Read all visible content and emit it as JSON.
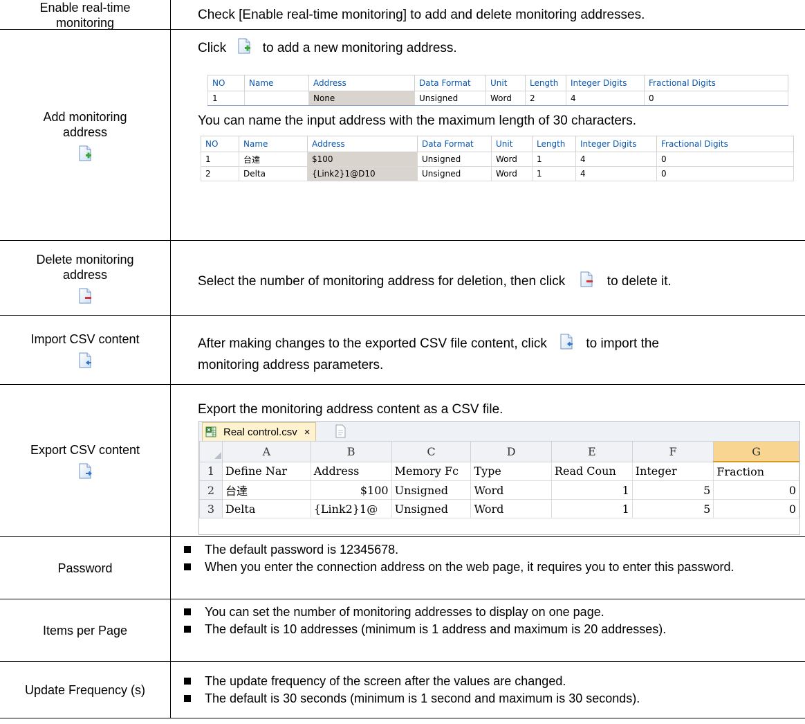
{
  "rows": {
    "enable": {
      "label": "Enable real-time monitoring",
      "text": "Check [Enable real-time monitoring] to add and delete monitoring addresses."
    },
    "add": {
      "label": "Add monitoring address",
      "text_click": "Click",
      "text_after": "to add a new monitoring address.",
      "text2": "You can name the input address with the maximum length of 30 characters."
    },
    "delete": {
      "label": "Delete monitoring address",
      "text_before": "Select the number of monitoring address for deletion, then click",
      "text_after": "to delete it."
    },
    "import": {
      "label": "Import CSV content",
      "text_before": "After making changes to the exported CSV file content, click",
      "text_after": "to import the",
      "text_line2": "monitoring address parameters."
    },
    "export": {
      "label": "Export CSV content",
      "text": "Export the monitoring address content as a CSV file."
    },
    "password": {
      "label": "Password",
      "bullets": [
        "The default password is 12345678.",
        "When you enter the connection address on the web page, it requires you to enter this password."
      ]
    },
    "items": {
      "label": "Items per Page",
      "bullets": [
        "You can set the number of monitoring addresses to display on one page.",
        "The default is 10 addresses (minimum is 1 address and maximum is 20 addresses)."
      ]
    },
    "update": {
      "label": "Update Frequency (s)",
      "bullets": [
        "The update frequency of the screen after the values are changed.",
        "The default is 30 seconds (minimum is 1 second and maximum is 30 seconds)."
      ]
    }
  },
  "grid1": {
    "headers": [
      "NO",
      "Name",
      "Address",
      "Data Format",
      "Unit",
      "Length",
      "Integer Digits",
      "Fractional Digits"
    ],
    "rows": [
      [
        "1",
        "",
        "None",
        "Unsigned",
        "Word",
        "2",
        "4",
        "0"
      ]
    ]
  },
  "grid2": {
    "headers": [
      "NO",
      "Name",
      "Address",
      "Data Format",
      "Unit",
      "Length",
      "Integer Digits",
      "Fractional Digits"
    ],
    "rows": [
      [
        "1",
        "台達",
        "$100",
        "Unsigned",
        "Word",
        "1",
        "4",
        "0"
      ],
      [
        "2",
        "Delta",
        "{Link2}1@D10",
        "Unsigned",
        "Word",
        "1",
        "4",
        "0"
      ]
    ]
  },
  "excel": {
    "tab_title": "Real control.csv",
    "tab_close": "×",
    "col_headers": [
      "A",
      "B",
      "C",
      "D",
      "E",
      "F",
      "G"
    ],
    "row_numbers": [
      "1",
      "2",
      "3"
    ],
    "rows": [
      [
        "Define Nar",
        "Address",
        "Memory Fc",
        "Type",
        "Read Coun",
        "Integer",
        "Fraction"
      ],
      [
        "台達",
        "$100",
        "Unsigned",
        "Word",
        "1",
        "5",
        "0"
      ],
      [
        "Delta",
        "{Link2}1@",
        "Unsigned",
        "Word",
        "1",
        "5",
        "0"
      ]
    ]
  },
  "icons": {
    "add": "file-add-icon",
    "delete": "file-delete-icon",
    "import": "file-import-icon",
    "export": "file-export-icon"
  },
  "colors": {
    "grid_header_text": "#0b57b0",
    "address_cell_bg": "#d9d4ce",
    "selected_col_bg": "#f8d692"
  }
}
